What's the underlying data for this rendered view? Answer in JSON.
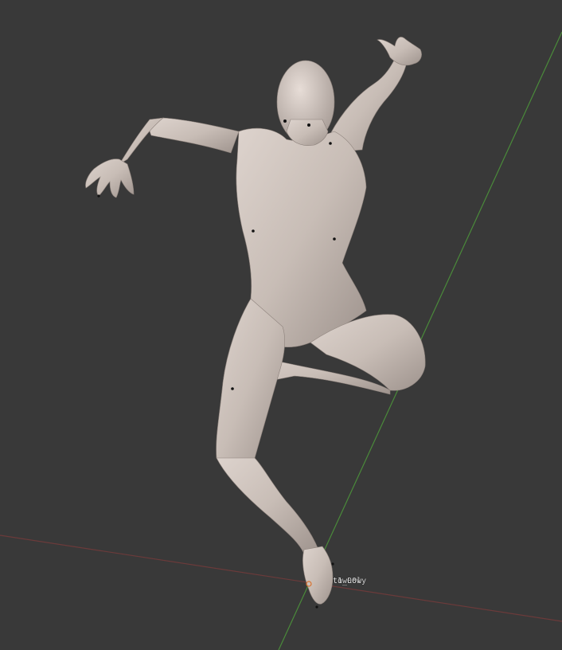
{
  "viewport": {
    "background": "#393939",
    "grid_x_axis_color": "#6b3a3a",
    "grid_y_axis_color": "#4a8a3a",
    "mesh_color": "#c9bfb8",
    "origin_color": "#d9722e"
  },
  "object_labels": {
    "primary": "t1_Low",
    "overlapping": "ow00ly"
  }
}
